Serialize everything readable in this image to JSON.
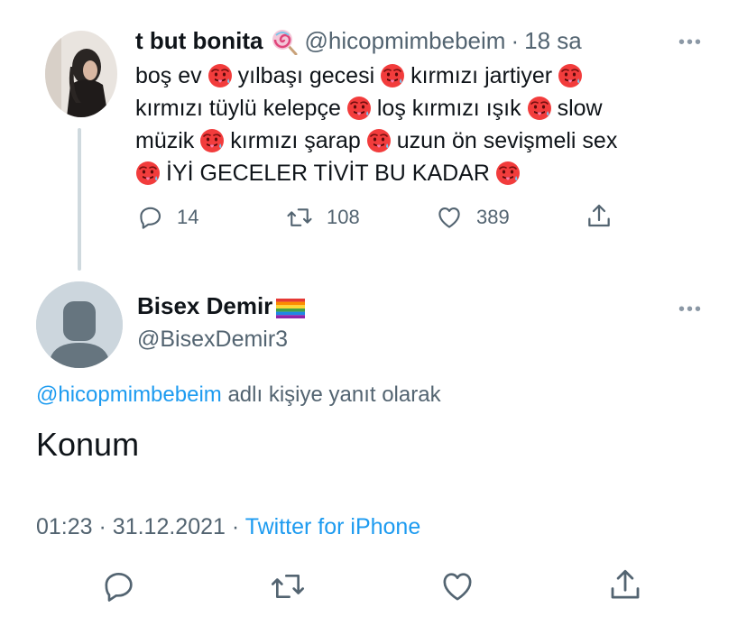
{
  "original_tweet": {
    "display_name": "t but bonita",
    "name_emoji": "lollipop",
    "handle": "@hicopmimbebeim",
    "separator": "·",
    "time_ago": "18 sa",
    "text_line1": [
      "boş ev",
      "yılbaşı gecesi",
      "kırmızı jartiyer"
    ],
    "text_line2": [
      "kırmızı tüylü kelepçe",
      "loş kırmızı ışık",
      "slow"
    ],
    "text_line3": [
      "müzik",
      "kırmızı şarap",
      "uzun ön sevişmeli sex"
    ],
    "text_line4": [
      "İYİ GECELER TİVİT BU KADAR"
    ],
    "inline_emoji": "hot-face",
    "reply_count": "14",
    "retweet_count": "108",
    "like_count": "389"
  },
  "reply_tweet": {
    "display_name": "Bisex Demir",
    "name_emoji": "rainbow-flag",
    "handle": "@BisexDemir3",
    "replying_to_handle": "@hicopmimbebeim",
    "replying_to_suffix": "adlı kişiye yanıt olarak",
    "text": "Konum",
    "time": "01:23",
    "dot1": "·",
    "date": "31.12.2021",
    "dot2": "·",
    "source": "Twitter for iPhone"
  },
  "more_glyph": "•••",
  "colors": {
    "link": "#1d9bf0",
    "muted": "#536471",
    "line": "#cfd9de"
  }
}
